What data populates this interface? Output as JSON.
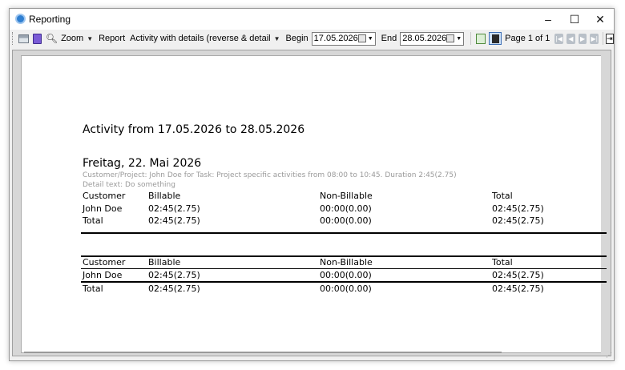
{
  "window": {
    "title": "Reporting",
    "minimize_glyph": "–",
    "maximize_glyph": "☐",
    "close_glyph": "✕"
  },
  "toolbar": {
    "zoom_label": "Zoom",
    "report_label": "Report",
    "report_selected": "Activity with details (reverse & detail",
    "begin_label": "Begin",
    "begin_value": "17.05.2026",
    "end_label": "End",
    "end_value": "28.05.2026",
    "page_label": "Page 1 of 1",
    "nav_first": "|◀",
    "nav_prev": "◀",
    "nav_next": "▶",
    "nav_last": "▶|",
    "exit_glyph": "⇥",
    "icons": [
      "printer-icon",
      "book-icon",
      "zoom-icon",
      "refresh-icon",
      "page-layout-icon",
      "exit-icon"
    ]
  },
  "report": {
    "title": "Activity from 17.05.2026 to 28.05.2026",
    "day_heading": "Freitag, 22. Mai 2026",
    "detail_line1": "Customer/Project: John Doe for Task: Project specific activities from 08:00 to 10:45. Duration 2:45(2.75)",
    "detail_line2": "Detail text: Do something",
    "day_table": {
      "headers": [
        "Customer",
        "Billable",
        "Non-Billable",
        "Total"
      ],
      "rows": [
        [
          "John Doe",
          "02:45(2.75)",
          "00:00(0.00)",
          "02:45(2.75)"
        ],
        [
          "Total",
          "02:45(2.75)",
          "00:00(0.00)",
          "02:45(2.75)"
        ]
      ]
    },
    "summary_table": {
      "headers": [
        "Customer",
        "Billable",
        "Non-Billable",
        "Total"
      ],
      "rows": [
        [
          "John Doe",
          "02:45(2.75)",
          "00:00(0.00)",
          "02:45(2.75)"
        ],
        [
          "Total",
          "02:45(2.75)",
          "00:00(0.00)",
          "02:45(2.75)"
        ]
      ]
    }
  }
}
